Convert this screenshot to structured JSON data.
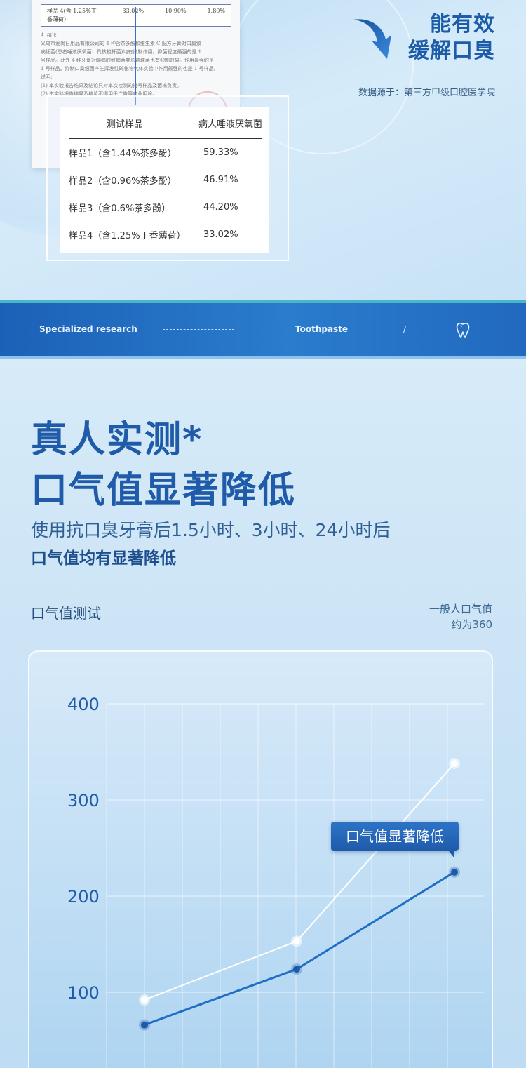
{
  "report": {
    "row_sample": "样品 4(含 1.25%丁香薄荷)",
    "row_v1": "33.02%",
    "row_v2": "10.90%",
    "row_v3": "1.80%",
    "section": "4. 结论",
    "lines": [
      "义乌市爱尚日用品有限公司的 4 种含茶多酚和维生素 C 配方牙膏对口臭致",
      "病细菌(患者唾液厌氧菌、具核梭杆菌)均有抑制作用。抑菌程度最强的是 1",
      "号样品。此外 4 种牙膏对龋病的致病菌变形链球菌也有抑制效果。作用最强的是",
      "1 号样品。抑制口臭细菌产生挥发性硫化物气体实验中作用最强的也是 1 号样品。",
      "说明:",
      "(1)  本实验报告结果及结论只对本次检测的批号样品及菌株负责。",
      "(2)  本实验报告结果及结论不得用于广告等商业用途。"
    ]
  },
  "results_table": {
    "headers": [
      "测试样品",
      "病人唾液厌氧菌"
    ],
    "rows": [
      {
        "sample": "样品1（含1.44%茶多酚）",
        "value": "59.33%"
      },
      {
        "sample": "样品2（含0.96%茶多酚）",
        "value": "46.91%"
      },
      {
        "sample": "样品3（含0.6%茶多酚）",
        "value": "44.20%"
      },
      {
        "sample": "样品4（含1.25%丁香薄荷）",
        "value": "33.02%"
      }
    ]
  },
  "hero": {
    "heading_line1": "能有效",
    "heading_line2": "缓解口臭",
    "source": "数据源于：第三方甲级口腔医学院"
  },
  "banner": {
    "left": "Specialized research",
    "middle": "Toothpaste",
    "slash": "/"
  },
  "section2": {
    "title_line1": "真人实测*",
    "title_line2": "口气值显著降低",
    "subtitle_line1": "使用抗口臭牙膏后1.5小时、3小时、24小时后",
    "subtitle_line2": "口气值均有显著降低",
    "chart_label": "口气值测试",
    "note_line1": "一般人口气值",
    "note_line2": "约为360",
    "tooltip": "口气值显著降低"
  },
  "colors": {
    "accent": "#1f5ba8",
    "series_dark": "#1f6fc4",
    "series_light": "#ffffff"
  },
  "chart_data": {
    "type": "line",
    "x": [
      1,
      2,
      3
    ],
    "ylim": [
      0,
      400
    ],
    "yticks": [
      100,
      200,
      300,
      400
    ],
    "series": [
      {
        "values": [
          92,
          153,
          338
        ]
      },
      {
        "values": [
          66,
          124,
          225
        ]
      }
    ],
    "grid": true
  }
}
